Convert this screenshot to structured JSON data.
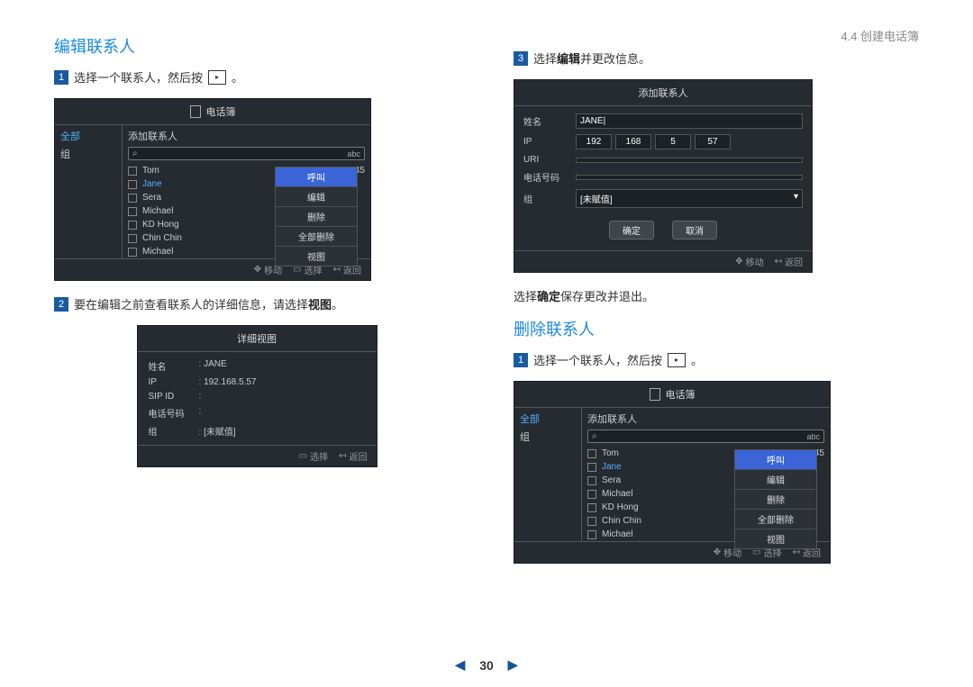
{
  "header": {
    "breadcrumb": "4.4 创建电话簿"
  },
  "left": {
    "title": "编辑联系人",
    "step1": {
      "num": "1",
      "text_a": "选择一个联系人，然后按",
      "text_b": "。"
    },
    "phonebook": {
      "title": "电话簿",
      "tab_all": "全部",
      "tab_group": "组",
      "add_contact": "添加联系人",
      "search_abc": "abc",
      "contacts": [
        {
          "name": "Tom",
          "ip": "217.141.3.245"
        },
        {
          "name": "Jane",
          "ip": ""
        },
        {
          "name": "Sera",
          "ip": ""
        },
        {
          "name": "Michael",
          "ip": ""
        },
        {
          "name": "KD Hong",
          "ip": ""
        },
        {
          "name": "Chin Chin",
          "ip": ""
        },
        {
          "name": "Michael",
          "ip": ""
        }
      ],
      "menu": {
        "call": "呼叫",
        "edit": "编辑",
        "delete": "删除",
        "delete_all": "全部删除",
        "view": "视图"
      },
      "footer": {
        "move": "移动",
        "select": "选择",
        "back": "返回"
      }
    },
    "step2": {
      "num": "2",
      "text_a": "要在编辑之前查看联系人的详细信息，请选择",
      "text_bold": "视图",
      "text_b": "。"
    },
    "detail": {
      "title": "详细视图",
      "rows": {
        "name_k": "姓名",
        "name_v": "JANE",
        "ip_k": "IP",
        "ip_v": "192.168.5.57",
        "sip_k": "SIP ID",
        "sip_v": "",
        "phone_k": "电话号码",
        "phone_v": "",
        "group_k": "组",
        "group_v": "[未赋值]"
      },
      "footer": {
        "select": "选择",
        "back": "返回"
      }
    }
  },
  "right": {
    "step3": {
      "num": "3",
      "text_a": "选择",
      "text_bold": "编辑",
      "text_b": "并更改信息。"
    },
    "form": {
      "title": "添加联系人",
      "fields": {
        "name_l": "姓名",
        "name_v": "JANE",
        "ip_l": "IP",
        "ip1": "192",
        "ip2": "168",
        "ip3": "5",
        "ip4": "57",
        "uri_l": "URI",
        "phone_l": "电话号码",
        "group_l": "组",
        "group_v": "[未赋值]"
      },
      "ok": "确定",
      "cancel": "取消",
      "footer": {
        "move": "移动",
        "back": "返回"
      }
    },
    "after_form": {
      "text_a": "选择",
      "text_bold": "确定",
      "text_b": "保存更改并退出。"
    },
    "delete_title": "删除联系人",
    "step1_del": {
      "num": "1",
      "text_a": "选择一个联系人，然后按",
      "text_b": "。"
    }
  },
  "pager": {
    "prev": "◀",
    "page": "30",
    "next": "▶"
  }
}
